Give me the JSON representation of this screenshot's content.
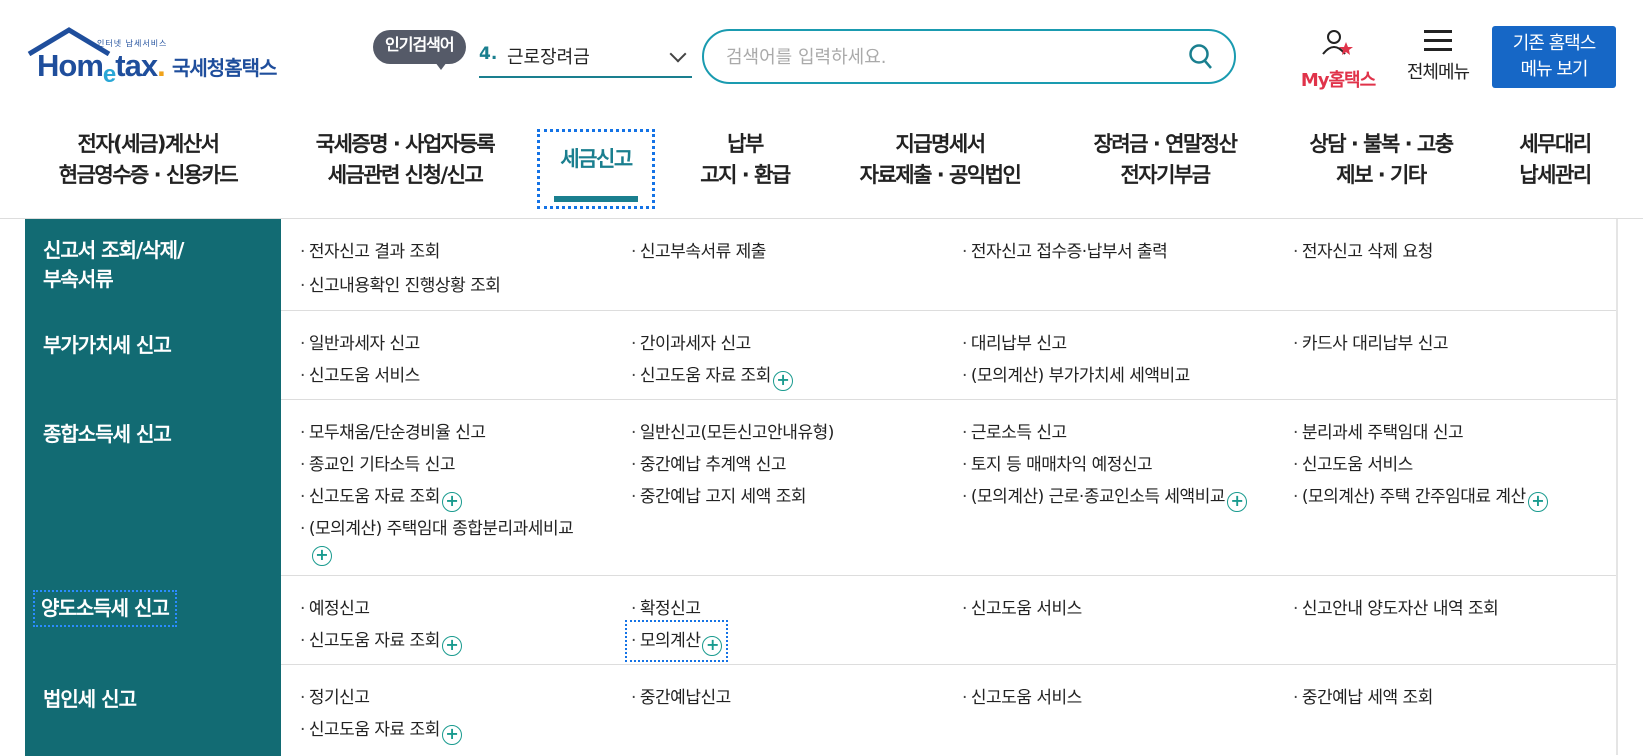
{
  "header": {
    "logo_small": "인터넷 납세서비스",
    "logo_prefix": "Hom",
    "logo_e": "e",
    "logo_suffix": "tax",
    "logo_dot": ".",
    "logo_korean": "국세청홈택스",
    "popular_badge": "인기검색어",
    "popular_rank": "4.",
    "popular_term": "근로장려금",
    "search_placeholder": "검색어를 입력하세요.",
    "my_hometax": "My홈택스",
    "all_menu": "전체메뉴",
    "old_menu_line1": "기존 홈택스",
    "old_menu_line2": "메뉴 보기"
  },
  "gnb": [
    {
      "l1": "전자(세금)계산서",
      "l2": "현금영수증 · 신용카드"
    },
    {
      "l1": "국세증명 · 사업자등록",
      "l2": "세금관련 신청/신고"
    },
    {
      "l1": "세금신고",
      "l2": ""
    },
    {
      "l1": "납부",
      "l2": "고지 · 환급"
    },
    {
      "l1": "지급명세서",
      "l2": "자료제출 · 공익법인"
    },
    {
      "l1": "장려금 · 연말정산",
      "l2": "전자기부금"
    },
    {
      "l1": "상담 · 불복 · 고충",
      "l2": "제보 · 기타"
    },
    {
      "l1": "세무대리",
      "l2": "납세관리"
    }
  ],
  "sections": [
    {
      "title_l1": "신고서 조회/삭제/",
      "title_l2": "부속서류",
      "items": [
        "전자신고 결과 조회",
        "신고부속서류 제출",
        "전자신고 접수증·납부서 출력",
        "전자신고 삭제 요청",
        "신고내용확인 진행상황 조회"
      ]
    },
    {
      "title_l1": "부가가치세 신고",
      "items": [
        "일반과세자 신고",
        "간이과세자 신고",
        "대리납부 신고",
        "카드사 대리납부 신고",
        "신고도움 서비스",
        "신고도움 자료 조회",
        "(모의계산) 부가가치세 세액비교"
      ]
    },
    {
      "title_l1": "종합소득세 신고",
      "items": [
        "모두채움/단순경비율 신고",
        "일반신고(모든신고안내유형)",
        "근로소득 신고",
        "분리과세 주택임대 신고",
        "종교인 기타소득 신고",
        "중간예납 추계액 신고",
        "토지 등 매매차익 예정신고",
        "신고도움 서비스",
        "신고도움 자료 조회",
        "중간예납 고지 세액 조회",
        "(모의계산) 근로·종교인소득 세액비교",
        "(모의계산) 주택 간주임대료 계산",
        "(모의계산) 주택임대 종합분리과세비교"
      ]
    },
    {
      "title_l1": "양도소득세 신고",
      "items": [
        "예정신고",
        "확정신고",
        "신고도움 서비스",
        "신고안내 양도자산 내역 조회",
        "신고도움 자료 조회",
        "모의계산"
      ]
    },
    {
      "title_l1": "법인세 신고",
      "items": [
        "정기신고",
        "중간예납신고",
        "신고도움 서비스",
        "중간예납 세액 조회",
        "신고도움 자료 조회"
      ]
    }
  ],
  "plus_symbol": "+"
}
